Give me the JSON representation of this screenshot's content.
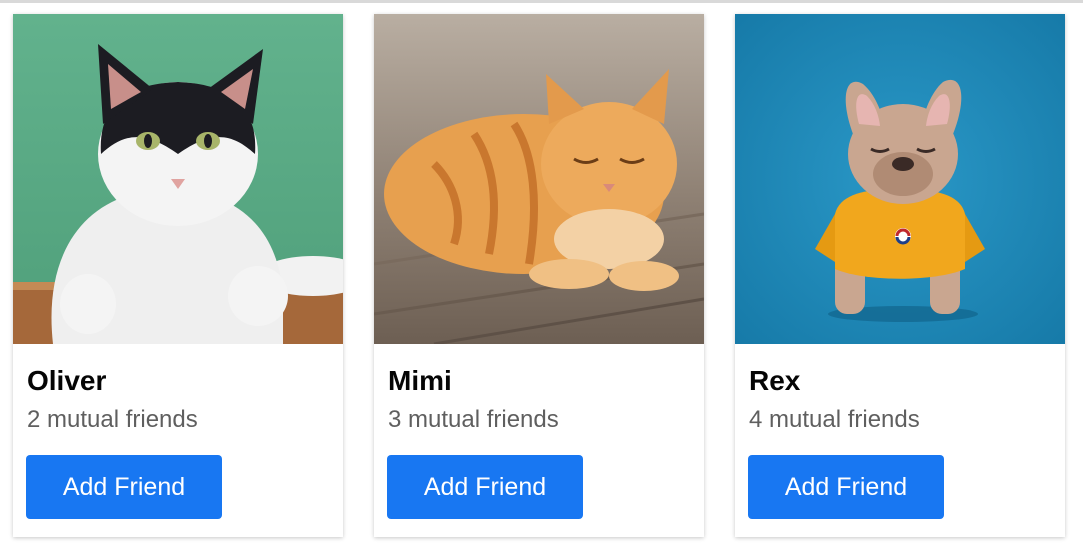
{
  "accent_color": "#1877f2",
  "friends": [
    {
      "name": "Oliver",
      "mutual": "2 mutual friends",
      "button_label": "Add Friend",
      "photo_icon": "tuxedo-cat-photo",
      "photo_bg": "#5fae88"
    },
    {
      "name": "Mimi",
      "mutual": "3 mutual friends",
      "button_label": "Add Friend",
      "photo_icon": "orange-tabby-cat-photo",
      "photo_bg": "#a59a8e"
    },
    {
      "name": "Rex",
      "mutual": "4 mutual friends",
      "button_label": "Add Friend",
      "photo_icon": "french-bulldog-photo",
      "photo_bg": "#1e87b6"
    }
  ]
}
